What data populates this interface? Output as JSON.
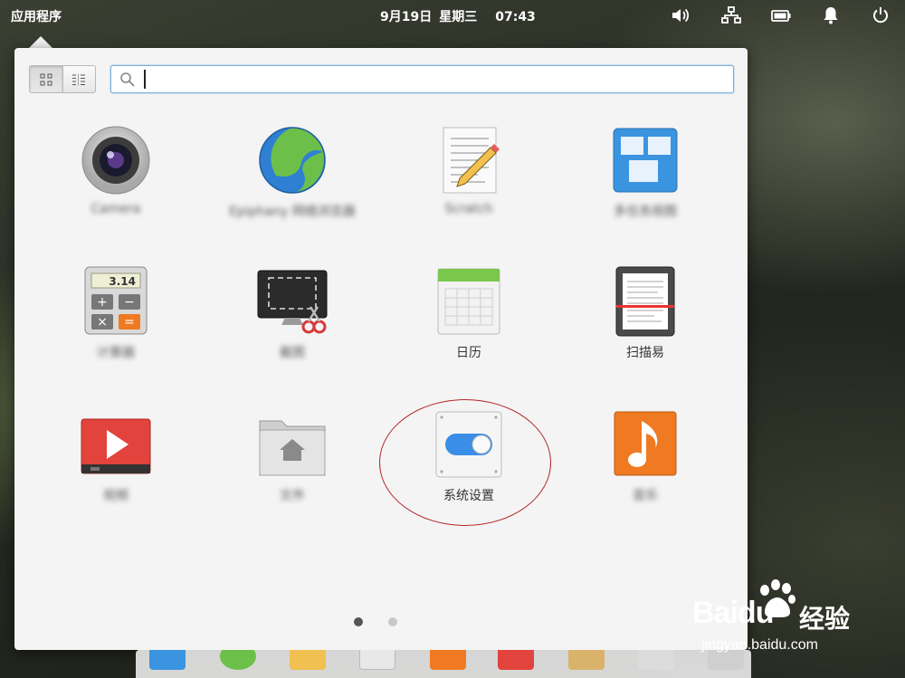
{
  "topbar": {
    "apps_label": "应用程序",
    "date": "9月19日",
    "weekday": "星期三",
    "time": "07:43",
    "indicators": [
      "volume-icon",
      "network-icon",
      "battery-icon",
      "notification-bell-icon",
      "power-icon"
    ]
  },
  "launcher": {
    "search": {
      "value": "",
      "placeholder": ""
    },
    "view_modes": [
      "grid-view-icon",
      "category-view-icon"
    ],
    "apps": [
      {
        "label": "Camera",
        "icon": "camera-app-icon",
        "blurred": true
      },
      {
        "label": "Epiphany 网络浏览器",
        "icon": "web-browser-app-icon",
        "blurred": true
      },
      {
        "label": "Scratch",
        "icon": "text-editor-app-icon",
        "blurred": true
      },
      {
        "label": "多任务视图",
        "icon": "multitasking-view-app-icon",
        "blurred": true
      },
      {
        "label": "计算器",
        "icon": "calculator-app-icon",
        "blurred": true,
        "display": "3.14"
      },
      {
        "label": "截图",
        "icon": "screenshot-app-icon",
        "blurred": true
      },
      {
        "label": "日历",
        "icon": "calendar-app-icon",
        "blurred": false
      },
      {
        "label": "扫描易",
        "icon": "scanner-app-icon",
        "blurred": false
      },
      {
        "label": "视频",
        "icon": "videos-app-icon",
        "blurred": true
      },
      {
        "label": "文件",
        "icon": "files-app-icon",
        "blurred": true
      },
      {
        "label": "系统设置",
        "icon": "system-settings-app-icon",
        "blurred": false
      },
      {
        "label": "音乐",
        "icon": "music-app-icon",
        "blurred": true
      }
    ],
    "pages": {
      "count": 2,
      "current": 1
    }
  },
  "watermark": {
    "brand_prefix": "Bai",
    "brand_suffix": "du",
    "product": "经验",
    "url": "jingyan.baidu.com"
  },
  "colors": {
    "accent": "#7fb0d8",
    "highlight_ring": "#b3262b",
    "panel_bg": "#f4f4f4"
  }
}
